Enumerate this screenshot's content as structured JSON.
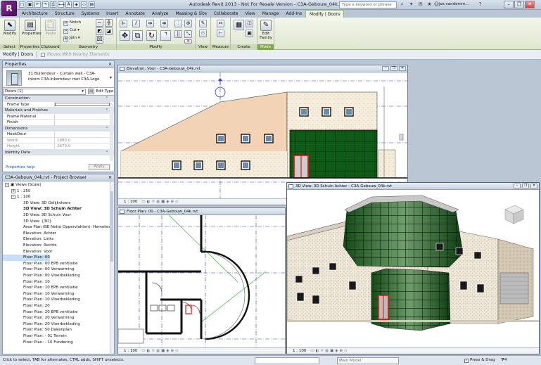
{
  "app": {
    "logo_letter": "R",
    "title": "Autodesk Revit 2013 - Not For Resale Version -    C3A-Gebouw_04k.rvt",
    "search_placeholder": "Type a keyword or phrase",
    "user": "jos.vandemm..."
  },
  "ribbon_tabs": [
    "Architecture",
    "Structure",
    "Systems",
    "Insert",
    "Annotate",
    "Analyze",
    "Massing & Site",
    "Collaborate",
    "View",
    "Manage",
    "Add-Ins",
    "Modify | Doors"
  ],
  "ribbon": {
    "select": {
      "button": "Modify",
      "label": "Select"
    },
    "properties": {
      "button": "Properties",
      "label": "Properties"
    },
    "clipboard": {
      "paste": "Paste",
      "label": "Clipboard"
    },
    "geometry": {
      "notch": "Notch",
      "cut": "Cut",
      "join": "Join",
      "label": "Geometry"
    },
    "modify": {
      "label": "Modify"
    },
    "view": {
      "label": "View"
    },
    "measure": {
      "label": "Measure"
    },
    "create": {
      "label": "Create"
    },
    "mode": {
      "button_line1": "Edit",
      "button_line2": "Family",
      "label": "Mode"
    }
  },
  "context_bar": {
    "label": "Modify | Doors",
    "option": "Moves With Nearby Elements"
  },
  "properties": {
    "header": "Properties",
    "type_name": "31 Buitendeur - Curtain wall - C3A-inkom C3A-Inkomdeur met C3A-Logo",
    "filter": "Doors (1)",
    "edit_type": "Edit Type",
    "rows": [
      {
        "key": "Construction",
        "group": true
      },
      {
        "key": "Frame Type",
        "value": ""
      },
      {
        "key": "Materials and Finishes",
        "group": true
      },
      {
        "key": "Frame Material",
        "value": ""
      },
      {
        "key": "Finish",
        "value": ""
      },
      {
        "key": "Dimensions",
        "group": true
      },
      {
        "key": "HoekDeur",
        "value": ""
      },
      {
        "key": "Width",
        "value": "1880.0",
        "grey": true
      },
      {
        "key": "Height",
        "value": "2670.0",
        "grey": true
      },
      {
        "key": "Identity Data",
        "group": true
      }
    ],
    "help": "Properties help",
    "apply": "Apply"
  },
  "project_browser": {
    "header": "C3A-Gebouw_04k.rvt - Project Browser",
    "nodes": [
      {
        "label": "Views (Scale)",
        "depth": 0,
        "exp": "-"
      },
      {
        "label": "1 : 250",
        "depth": 1,
        "exp": "+"
      },
      {
        "label": "1 : 100",
        "depth": 1,
        "exp": "-"
      },
      {
        "label": "3D View: 3D Gelijkvloers",
        "depth": 2
      },
      {
        "label": "3D View: 3D Schuin Achter",
        "depth": 2,
        "bold": true
      },
      {
        "label": "3D View: 3D Schuin Voor",
        "depth": 2
      },
      {
        "label": "3D View: {3D}",
        "depth": 2
      },
      {
        "label": "Area Plan (BE Netto Oppervlakten): Hemelwat",
        "depth": 2
      },
      {
        "label": "Elevation: Achter",
        "depth": 2
      },
      {
        "label": "Elevation: Links",
        "depth": 2
      },
      {
        "label": "Elevation: Rechts",
        "depth": 2
      },
      {
        "label": "Elevation: Voor",
        "depth": 2
      },
      {
        "label": "Floor Plan: 00",
        "depth": 2,
        "sel": true
      },
      {
        "label": "Floor Plan: 00 EPB ventilatie",
        "depth": 2
      },
      {
        "label": "Floor Plan: 00 Verwarming",
        "depth": 2
      },
      {
        "label": "Floor Plan: 00 Vloerbekleding",
        "depth": 2
      },
      {
        "label": "Floor Plan: 10",
        "depth": 2
      },
      {
        "label": "Floor Plan: 10 EPB ventilatie",
        "depth": 2
      },
      {
        "label": "Floor Plan: 10 Verwarming",
        "depth": 2
      },
      {
        "label": "Floor Plan: 10 Vloerbekleding",
        "depth": 2
      },
      {
        "label": "Floor Plan: 20",
        "depth": 2
      },
      {
        "label": "Floor Plan: 20 EPB ventilatie",
        "depth": 2
      },
      {
        "label": "Floor Plan: 20 Verwarming",
        "depth": 2
      },
      {
        "label": "Floor Plan: 20 Vloerbekleding",
        "depth": 2
      },
      {
        "label": "Floor Plan: 50 Dakenplan",
        "depth": 2
      },
      {
        "label": "Floor Plan: - 01 Terrein",
        "depth": 2
      },
      {
        "label": "Floor Plan: - 10 Fundering",
        "depth": 2
      }
    ]
  },
  "views": {
    "elevation": {
      "title": "Elevation: Voor - C3A-Gebouw_04k.rvt",
      "scale": "1 : 100"
    },
    "floorplan": {
      "title": "Floor Plan: 00 - C3A-Gebouw_04k.rvt",
      "scale": "1 : 100"
    },
    "view3d": {
      "title": "3D View: 3D Schuin Achter - C3A-Gebouw_04k.rvt",
      "scale": "1 : 100"
    }
  },
  "status": {
    "text": "Click to select, TAB for alternates, CTRL adds, SHIFT unselects.",
    "model": "Main Model",
    "press_drag": "Press & Drag",
    "filter_count": "4"
  }
}
